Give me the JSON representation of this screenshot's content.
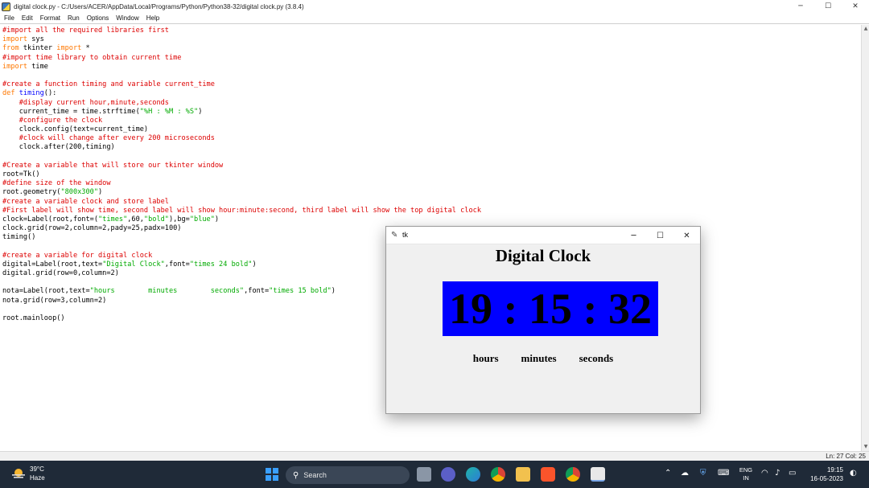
{
  "idle": {
    "title": "digital clock.py - C:/Users/ACER/AppData/Local/Programs/Python/Python38-32/digital clock.py (3.8.4)",
    "menu": [
      "File",
      "Edit",
      "Format",
      "Run",
      "Options",
      "Window",
      "Help"
    ],
    "status": "Ln: 27   Col: 25",
    "window_controls": {
      "minimize": "─",
      "maximize": "☐",
      "close": "✕"
    }
  },
  "code": [
    [
      [
        "comment",
        "#import all the required libraries first"
      ]
    ],
    [
      [
        "kw",
        "import"
      ],
      [
        "text",
        " sys"
      ]
    ],
    [
      [
        "kw",
        "from"
      ],
      [
        "text",
        " tkinter "
      ],
      [
        "kw",
        "import"
      ],
      [
        "text",
        " *"
      ]
    ],
    [
      [
        "comment",
        "#import time library to obtain current time"
      ]
    ],
    [
      [
        "kw",
        "import"
      ],
      [
        "text",
        " time"
      ]
    ],
    [
      [
        "text",
        ""
      ]
    ],
    [
      [
        "comment",
        "#create a function timing and variable current_time"
      ]
    ],
    [
      [
        "kw",
        "def"
      ],
      [
        "text",
        " "
      ],
      [
        "def",
        "timing"
      ],
      [
        "text",
        "():"
      ]
    ],
    [
      [
        "text",
        "    "
      ],
      [
        "comment",
        "#display current hour,minute,seconds"
      ]
    ],
    [
      [
        "text",
        "    current_time = time.strftime("
      ],
      [
        "str",
        "\"%H : %M : %S\""
      ],
      [
        "text",
        ")"
      ]
    ],
    [
      [
        "text",
        "    "
      ],
      [
        "comment",
        "#configure the clock"
      ]
    ],
    [
      [
        "text",
        "    clock.config(text=current_time)"
      ]
    ],
    [
      [
        "text",
        "    "
      ],
      [
        "comment",
        "#clock will change after every 200 microseconds"
      ]
    ],
    [
      [
        "text",
        "    clock.after(200,timing)"
      ]
    ],
    [
      [
        "text",
        ""
      ]
    ],
    [
      [
        "comment",
        "#Create a variable that will store our tkinter window"
      ]
    ],
    [
      [
        "text",
        "root=Tk()"
      ]
    ],
    [
      [
        "comment",
        "#define size of the window"
      ]
    ],
    [
      [
        "text",
        "root.geometry("
      ],
      [
        "str",
        "\"800x300\""
      ],
      [
        "text",
        ")"
      ]
    ],
    [
      [
        "comment",
        "#create a variable clock and store label"
      ]
    ],
    [
      [
        "comment",
        "#First label will show time, second label will show hour:minute:second, third label will show the top digital clock"
      ]
    ],
    [
      [
        "text",
        "clock=Label(root,font=("
      ],
      [
        "str",
        "\"times\""
      ],
      [
        "text",
        ",60,"
      ],
      [
        "str",
        "\"bold\""
      ],
      [
        "text",
        "),bg="
      ],
      [
        "str",
        "\"blue\""
      ],
      [
        "text",
        ")"
      ]
    ],
    [
      [
        "text",
        "clock.grid(row=2,column=2,pady=25,padx=100)"
      ]
    ],
    [
      [
        "text",
        "timing()"
      ]
    ],
    [
      [
        "text",
        ""
      ]
    ],
    [
      [
        "comment",
        "#create a variable for digital clock"
      ]
    ],
    [
      [
        "text",
        "digital=Label(root,text="
      ],
      [
        "str",
        "\"Digital Clock\""
      ],
      [
        "text",
        ",font="
      ],
      [
        "str",
        "\"times 24 bold\""
      ],
      [
        "text",
        ")"
      ]
    ],
    [
      [
        "text",
        "digital.grid(row=0,column=2)"
      ]
    ],
    [
      [
        "text",
        ""
      ]
    ],
    [
      [
        "text",
        "nota=Label(root,text="
      ],
      [
        "str",
        "\"hours        minutes        seconds\""
      ],
      [
        "text",
        ",font="
      ],
      [
        "str",
        "\"times 15 bold\""
      ],
      [
        "text",
        ")"
      ]
    ],
    [
      [
        "text",
        "nota.grid(row=3,column=2)"
      ]
    ],
    [
      [
        "text",
        ""
      ]
    ],
    [
      [
        "text",
        "root.mainloop()"
      ]
    ]
  ],
  "tk": {
    "title": "tk",
    "heading": "Digital Clock",
    "time": "19 : 15 : 32",
    "units": [
      "hours",
      "minutes",
      "seconds"
    ],
    "clock_bg": "#0000ff",
    "controls": {
      "minimize": "─",
      "maximize": "☐",
      "close": "✕"
    }
  },
  "taskbar": {
    "weather_temp": "39°C",
    "weather_cond": "Haze",
    "search_label": "Search",
    "lang_top": "ENG",
    "lang_bottom": "IN",
    "time": "19:15",
    "date": "16-05-2023",
    "apps": [
      "task-view-icon",
      "meet-icon",
      "edge-icon",
      "chrome-icon",
      "file-explorer-icon",
      "brave-icon",
      "chrome-profile-icon",
      "idle-app-icon"
    ]
  }
}
